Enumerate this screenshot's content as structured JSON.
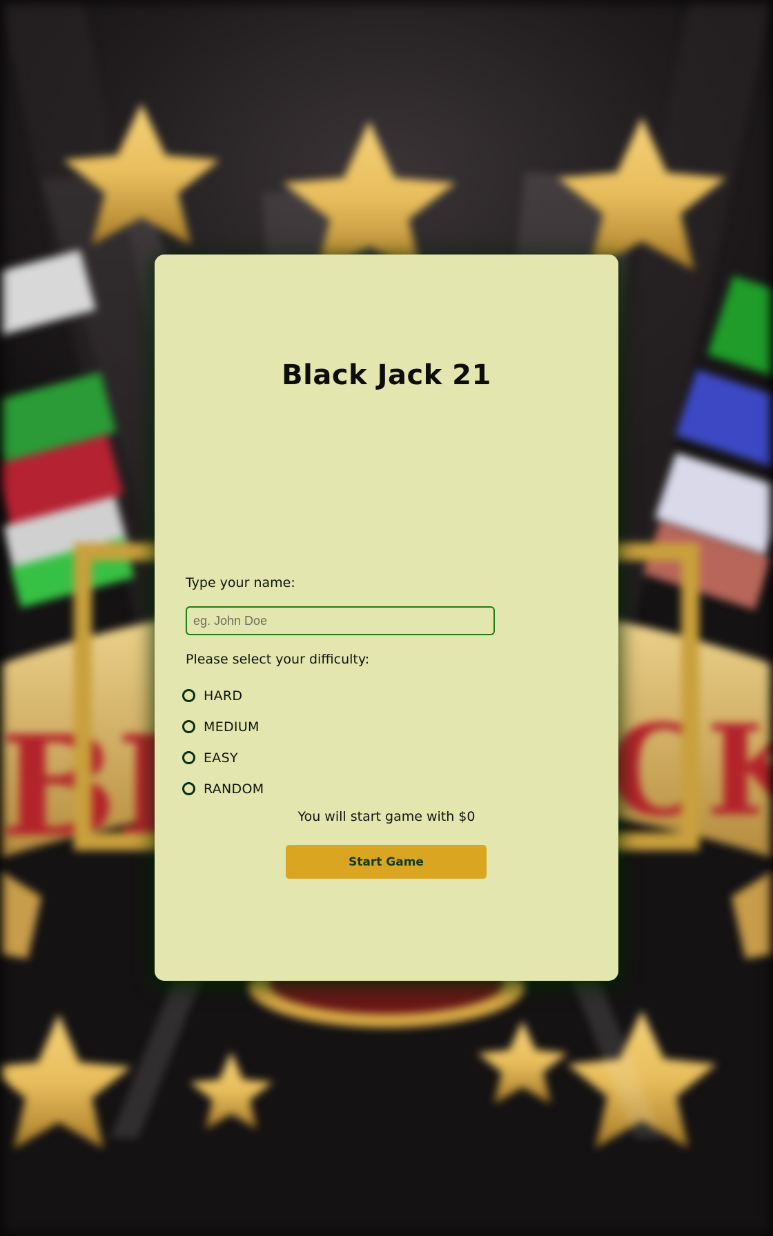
{
  "app": {
    "title": "Black Jack 21"
  },
  "form": {
    "name_label": "Type your name:",
    "name_placeholder": "eg. John Doe",
    "name_value": "",
    "difficulty_label": "Please select your difficulty:",
    "difficulties": [
      {
        "label": "HARD",
        "selected": false
      },
      {
        "label": "MEDIUM",
        "selected": false
      },
      {
        "label": "EASY",
        "selected": false
      },
      {
        "label": "RANDOM",
        "selected": false
      }
    ],
    "balance_text": "You will start game with $0",
    "start_button_label": "Start Game"
  },
  "colors": {
    "card_background": "#e3e6ae",
    "input_border": "#1d7d16",
    "button_background": "#daa520",
    "button_text": "#123a14",
    "radio_border": "#0c2d12"
  }
}
